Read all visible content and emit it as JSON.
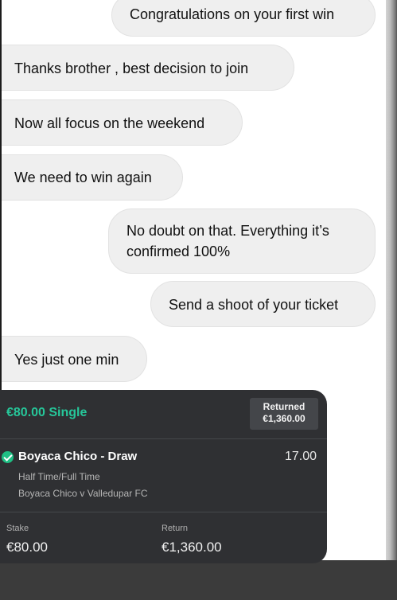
{
  "messages": [
    {
      "text": "Congratulations on your first win",
      "direction": "outgoing"
    },
    {
      "text": "Thanks brother , best decision to join",
      "direction": "incoming"
    },
    {
      "text": "Now all focus on the weekend",
      "direction": "incoming"
    },
    {
      "text": "We need to win again",
      "direction": "incoming"
    },
    {
      "text": "No doubt on that. Everything it’s\nconfirmed 100%",
      "direction": "outgoing"
    },
    {
      "text": "Send a shoot of your ticket",
      "direction": "outgoing"
    },
    {
      "text": "Yes just one min",
      "direction": "incoming"
    }
  ],
  "ticket": {
    "title": "€80.00 Single",
    "returned_label": "Returned",
    "returned_value": "€1,360.00",
    "selection": "Boyaca Chico - Draw",
    "odds": "17.00",
    "market": "Half Time/Full Time",
    "event": "Boyaca Chico v Valledupar FC",
    "stake_label": "Stake",
    "stake_value": "€80.00",
    "return_label": "Return",
    "return_value": "€1,360.00",
    "accent_color": "#26c79a",
    "status_icon": "check-circle-icon"
  },
  "colors": {
    "bubble_bg": "#efefef",
    "ticket_bg": "#2f3033",
    "page_bg": "#ffffff"
  }
}
